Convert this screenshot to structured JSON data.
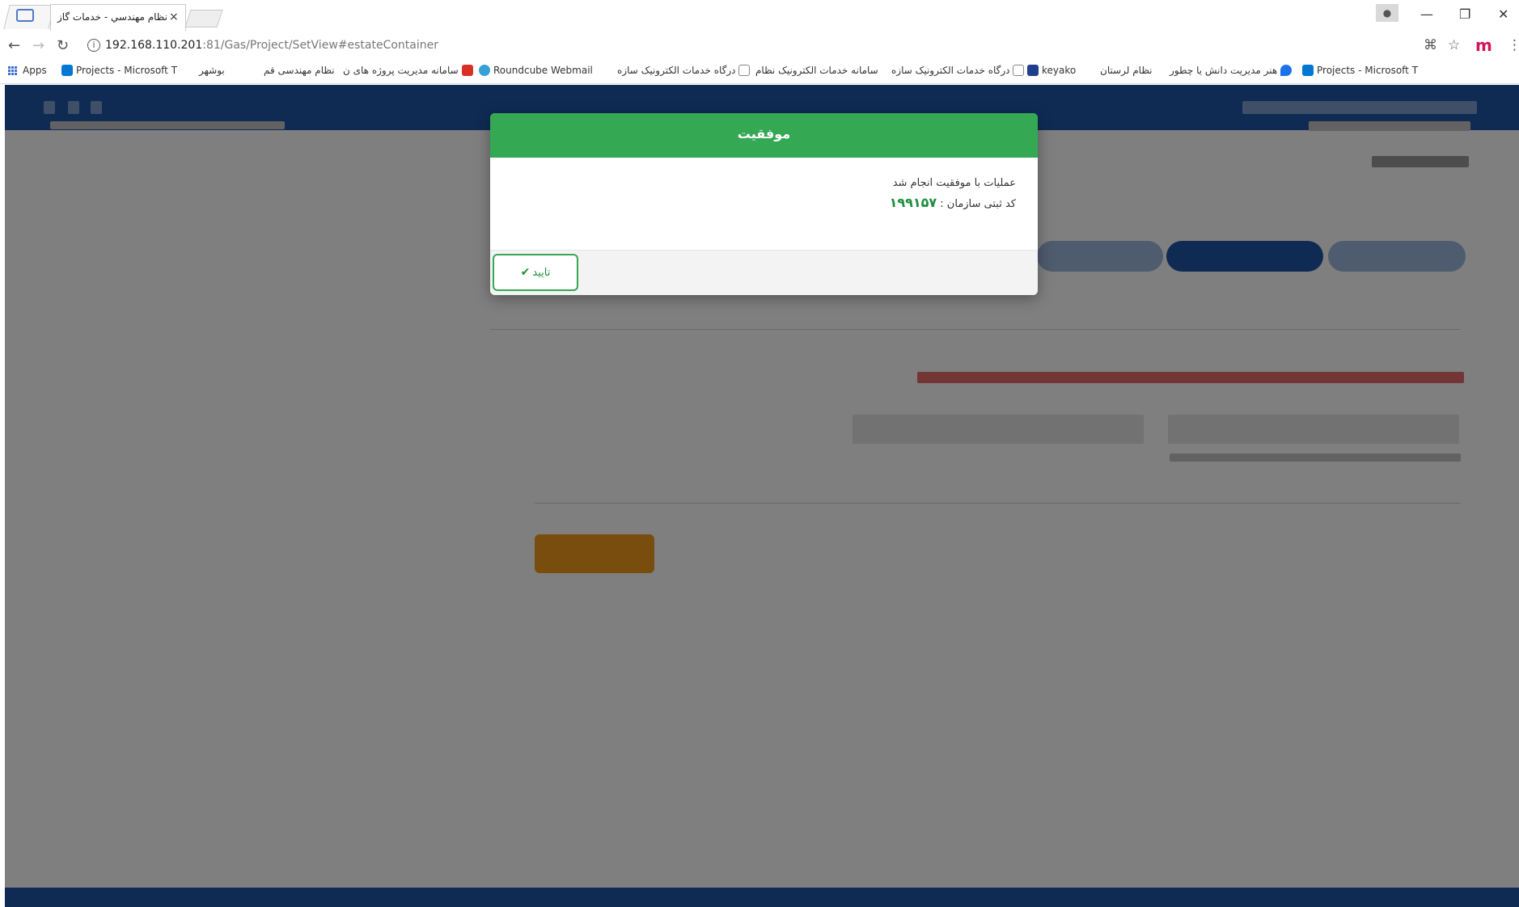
{
  "browser": {
    "tab_title": "نظام مهندسي - خدمات گاز",
    "tab_close": "×",
    "url_host": "192.168.110.201",
    "url_rest": ":81/Gas/Project/SetView#estateContainer",
    "bookmarks": [
      {
        "label": "Apps",
        "icon": "apps-icon",
        "color": "#3b6ed1"
      },
      {
        "label": "Projects - Microsoft T",
        "icon": "microsoft-icon",
        "color": "#0078d4"
      },
      {
        "label": "بوشهر",
        "icon": "page-icon",
        "color": "#cccccc"
      },
      {
        "label": "نظام مهندسی قم",
        "icon": "page-icon",
        "color": "#cccccc"
      },
      {
        "label": "سامانه مدیریت پروژه های ن",
        "icon": "bookmark-red-icon",
        "color": "#d93025"
      },
      {
        "label": "Roundcube Webmail",
        "icon": "roundcube-icon",
        "color": "#37a0d8"
      },
      {
        "label": "درگاه خدمات الکترونیک سازه",
        "icon": "doc-icon",
        "color": "#888888"
      },
      {
        "label": "سامانه خدمات الکترونیک نظام",
        "icon": "page-icon",
        "color": "#cccccc"
      },
      {
        "label": "درگاه خدمات الکترونیک سازه",
        "icon": "doc-icon",
        "color": "#888888"
      },
      {
        "label": "keyako",
        "icon": "keyako-icon",
        "color": "#1f3e8c"
      },
      {
        "label": "نظام لرستان",
        "icon": "page-icon",
        "color": "#cccccc"
      },
      {
        "label": "هنر مدیریت دانش یا چطور",
        "icon": "location-icon",
        "color": "#1a73e8"
      },
      {
        "label": "Projects - Microsoft T",
        "icon": "microsoft-icon",
        "color": "#0078d4"
      }
    ]
  },
  "modal": {
    "title": "موفقیت",
    "message": "عملیات با موفقیت انجام شد",
    "code_label": "کد ثبتی سازمان :",
    "code_value": "۱۹۹۱۵۷",
    "ok_label": "تایید",
    "colors": {
      "header": "#34a853",
      "code": "#1e8e3e"
    }
  },
  "page": {
    "header_color": "#1e56a8",
    "accent_button_color": "#f29a1c"
  }
}
